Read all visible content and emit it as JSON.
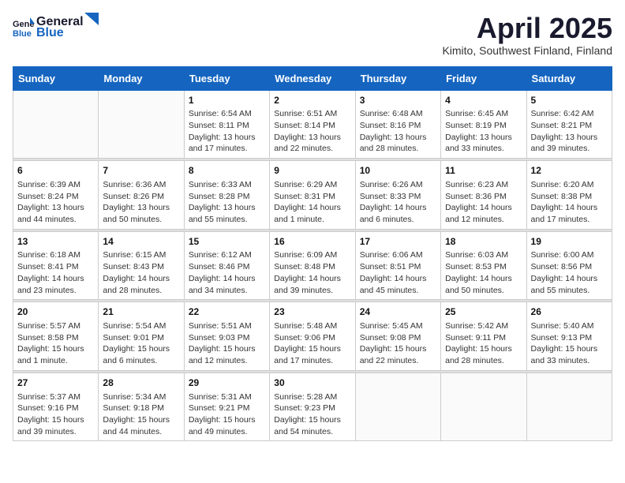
{
  "header": {
    "logo_general": "General",
    "logo_blue": "Blue",
    "title": "April 2025",
    "location": "Kimito, Southwest Finland, Finland"
  },
  "weekdays": [
    "Sunday",
    "Monday",
    "Tuesday",
    "Wednesday",
    "Thursday",
    "Friday",
    "Saturday"
  ],
  "weeks": [
    [
      {
        "day": "",
        "sunrise": "",
        "sunset": "",
        "daylight": ""
      },
      {
        "day": "",
        "sunrise": "",
        "sunset": "",
        "daylight": ""
      },
      {
        "day": "1",
        "sunrise": "Sunrise: 6:54 AM",
        "sunset": "Sunset: 8:11 PM",
        "daylight": "Daylight: 13 hours and 17 minutes."
      },
      {
        "day": "2",
        "sunrise": "Sunrise: 6:51 AM",
        "sunset": "Sunset: 8:14 PM",
        "daylight": "Daylight: 13 hours and 22 minutes."
      },
      {
        "day": "3",
        "sunrise": "Sunrise: 6:48 AM",
        "sunset": "Sunset: 8:16 PM",
        "daylight": "Daylight: 13 hours and 28 minutes."
      },
      {
        "day": "4",
        "sunrise": "Sunrise: 6:45 AM",
        "sunset": "Sunset: 8:19 PM",
        "daylight": "Daylight: 13 hours and 33 minutes."
      },
      {
        "day": "5",
        "sunrise": "Sunrise: 6:42 AM",
        "sunset": "Sunset: 8:21 PM",
        "daylight": "Daylight: 13 hours and 39 minutes."
      }
    ],
    [
      {
        "day": "6",
        "sunrise": "Sunrise: 6:39 AM",
        "sunset": "Sunset: 8:24 PM",
        "daylight": "Daylight: 13 hours and 44 minutes."
      },
      {
        "day": "7",
        "sunrise": "Sunrise: 6:36 AM",
        "sunset": "Sunset: 8:26 PM",
        "daylight": "Daylight: 13 hours and 50 minutes."
      },
      {
        "day": "8",
        "sunrise": "Sunrise: 6:33 AM",
        "sunset": "Sunset: 8:28 PM",
        "daylight": "Daylight: 13 hours and 55 minutes."
      },
      {
        "day": "9",
        "sunrise": "Sunrise: 6:29 AM",
        "sunset": "Sunset: 8:31 PM",
        "daylight": "Daylight: 14 hours and 1 minute."
      },
      {
        "day": "10",
        "sunrise": "Sunrise: 6:26 AM",
        "sunset": "Sunset: 8:33 PM",
        "daylight": "Daylight: 14 hours and 6 minutes."
      },
      {
        "day": "11",
        "sunrise": "Sunrise: 6:23 AM",
        "sunset": "Sunset: 8:36 PM",
        "daylight": "Daylight: 14 hours and 12 minutes."
      },
      {
        "day": "12",
        "sunrise": "Sunrise: 6:20 AM",
        "sunset": "Sunset: 8:38 PM",
        "daylight": "Daylight: 14 hours and 17 minutes."
      }
    ],
    [
      {
        "day": "13",
        "sunrise": "Sunrise: 6:18 AM",
        "sunset": "Sunset: 8:41 PM",
        "daylight": "Daylight: 14 hours and 23 minutes."
      },
      {
        "day": "14",
        "sunrise": "Sunrise: 6:15 AM",
        "sunset": "Sunset: 8:43 PM",
        "daylight": "Daylight: 14 hours and 28 minutes."
      },
      {
        "day": "15",
        "sunrise": "Sunrise: 6:12 AM",
        "sunset": "Sunset: 8:46 PM",
        "daylight": "Daylight: 14 hours and 34 minutes."
      },
      {
        "day": "16",
        "sunrise": "Sunrise: 6:09 AM",
        "sunset": "Sunset: 8:48 PM",
        "daylight": "Daylight: 14 hours and 39 minutes."
      },
      {
        "day": "17",
        "sunrise": "Sunrise: 6:06 AM",
        "sunset": "Sunset: 8:51 PM",
        "daylight": "Daylight: 14 hours and 45 minutes."
      },
      {
        "day": "18",
        "sunrise": "Sunrise: 6:03 AM",
        "sunset": "Sunset: 8:53 PM",
        "daylight": "Daylight: 14 hours and 50 minutes."
      },
      {
        "day": "19",
        "sunrise": "Sunrise: 6:00 AM",
        "sunset": "Sunset: 8:56 PM",
        "daylight": "Daylight: 14 hours and 55 minutes."
      }
    ],
    [
      {
        "day": "20",
        "sunrise": "Sunrise: 5:57 AM",
        "sunset": "Sunset: 8:58 PM",
        "daylight": "Daylight: 15 hours and 1 minute."
      },
      {
        "day": "21",
        "sunrise": "Sunrise: 5:54 AM",
        "sunset": "Sunset: 9:01 PM",
        "daylight": "Daylight: 15 hours and 6 minutes."
      },
      {
        "day": "22",
        "sunrise": "Sunrise: 5:51 AM",
        "sunset": "Sunset: 9:03 PM",
        "daylight": "Daylight: 15 hours and 12 minutes."
      },
      {
        "day": "23",
        "sunrise": "Sunrise: 5:48 AM",
        "sunset": "Sunset: 9:06 PM",
        "daylight": "Daylight: 15 hours and 17 minutes."
      },
      {
        "day": "24",
        "sunrise": "Sunrise: 5:45 AM",
        "sunset": "Sunset: 9:08 PM",
        "daylight": "Daylight: 15 hours and 22 minutes."
      },
      {
        "day": "25",
        "sunrise": "Sunrise: 5:42 AM",
        "sunset": "Sunset: 9:11 PM",
        "daylight": "Daylight: 15 hours and 28 minutes."
      },
      {
        "day": "26",
        "sunrise": "Sunrise: 5:40 AM",
        "sunset": "Sunset: 9:13 PM",
        "daylight": "Daylight: 15 hours and 33 minutes."
      }
    ],
    [
      {
        "day": "27",
        "sunrise": "Sunrise: 5:37 AM",
        "sunset": "Sunset: 9:16 PM",
        "daylight": "Daylight: 15 hours and 39 minutes."
      },
      {
        "day": "28",
        "sunrise": "Sunrise: 5:34 AM",
        "sunset": "Sunset: 9:18 PM",
        "daylight": "Daylight: 15 hours and 44 minutes."
      },
      {
        "day": "29",
        "sunrise": "Sunrise: 5:31 AM",
        "sunset": "Sunset: 9:21 PM",
        "daylight": "Daylight: 15 hours and 49 minutes."
      },
      {
        "day": "30",
        "sunrise": "Sunrise: 5:28 AM",
        "sunset": "Sunset: 9:23 PM",
        "daylight": "Daylight: 15 hours and 54 minutes."
      },
      {
        "day": "",
        "sunrise": "",
        "sunset": "",
        "daylight": ""
      },
      {
        "day": "",
        "sunrise": "",
        "sunset": "",
        "daylight": ""
      },
      {
        "day": "",
        "sunrise": "",
        "sunset": "",
        "daylight": ""
      }
    ]
  ]
}
